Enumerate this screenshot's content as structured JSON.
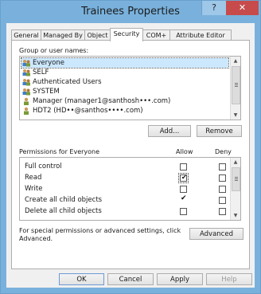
{
  "window": {
    "title": "Trainees Properties",
    "help_glyph": "?",
    "close_glyph": "✕"
  },
  "tabs": [
    {
      "label": "General"
    },
    {
      "label": "Managed By"
    },
    {
      "label": "Object"
    },
    {
      "label": "Security",
      "selected": true
    },
    {
      "label": "COM+"
    },
    {
      "label": "Attribute Editor"
    }
  ],
  "security": {
    "group_label": "Group or user names:",
    "principals": [
      {
        "name": "Everyone",
        "icon": "group-icon",
        "selected": true
      },
      {
        "name": "SELF",
        "icon": "group-icon"
      },
      {
        "name": "Authenticated Users",
        "icon": "group-icon"
      },
      {
        "name": "SYSTEM",
        "icon": "group-icon"
      },
      {
        "name": "Manager (manager1@santhosh•••.com)",
        "icon": "user-icon"
      },
      {
        "name": "HDT2 (HD••@santhos••••.com)",
        "icon": "user-icon"
      }
    ],
    "add_label": "Add...",
    "remove_label": "Remove",
    "permissions_label": "Permissions for Everyone",
    "allow_label": "Allow",
    "deny_label": "Deny",
    "permissions": [
      {
        "name": "Full control",
        "allow": false,
        "deny": false
      },
      {
        "name": "Read",
        "allow": true,
        "deny": false
      },
      {
        "name": "Write",
        "allow": false,
        "deny": false
      },
      {
        "name": "Create all child objects",
        "allow": true,
        "deny": false
      },
      {
        "name": "Delete all child objects",
        "allow": false,
        "deny": false
      }
    ],
    "special_text_line1": "For special permissions or advanced settings, click",
    "special_text_line2": "Advanced.",
    "advanced_label": "Advanced"
  },
  "footer": {
    "ok_label": "OK",
    "cancel_label": "Cancel",
    "apply_label": "Apply",
    "help_label": "Help"
  },
  "colors": {
    "frame": "#79b1dc",
    "close": "#c74b4b",
    "selection": "#cce8ff"
  }
}
